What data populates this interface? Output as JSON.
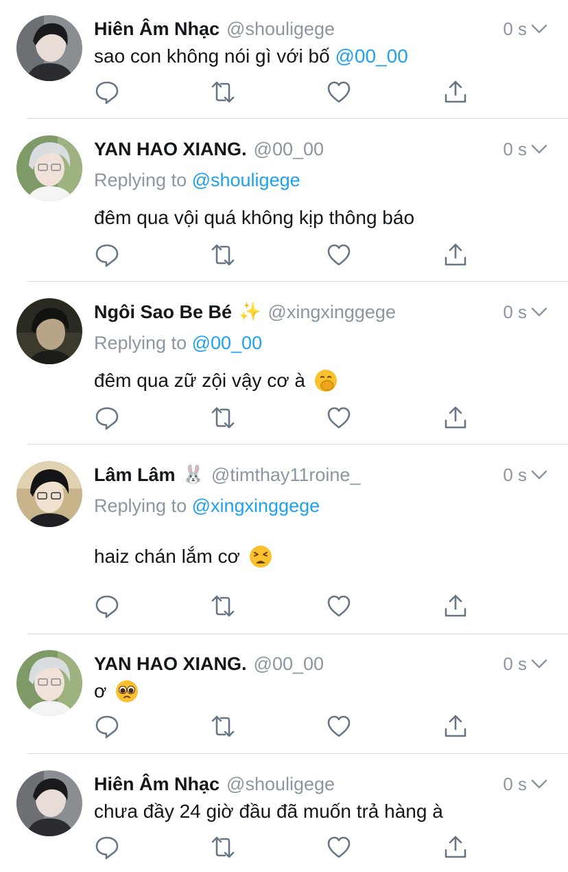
{
  "tweets": [
    {
      "display_name": "Hiên Âm Nhạc",
      "name_emoji": "",
      "handle": "@shouligege",
      "time": "0 s",
      "replying_label": "",
      "replying_to": "",
      "text": "sao con không nói gì với bố ",
      "text_mention": "@00_00",
      "text_emoji": ""
    },
    {
      "display_name": "YAN HAO XIANG.",
      "name_emoji": "",
      "handle": "@00_00",
      "time": "0 s",
      "replying_label": "Replying to ",
      "replying_to": "@shouligege",
      "text": "đêm qua vội quá không kịp thông báo",
      "text_mention": "",
      "text_emoji": ""
    },
    {
      "display_name": "Ngôi Sao Be Bé",
      "name_emoji": "✨",
      "handle": "@xingxinggege",
      "time": "0 s",
      "replying_label": "Replying to ",
      "replying_to": "@00_00",
      "text": "đêm qua zữ zội vậy cơ à",
      "text_mention": "",
      "text_emoji": "face-with-hand-over-mouth"
    },
    {
      "display_name": "Lâm Lâm",
      "name_emoji": "🐰",
      "handle": "@timthay11roine_",
      "time": "0 s",
      "replying_label": "Replying to ",
      "replying_to": "@xingxinggege",
      "text": "haiz chán lắm cơ",
      "text_mention": "",
      "text_emoji": "weary-face"
    },
    {
      "display_name": "YAN HAO XIANG.",
      "name_emoji": "",
      "handle": "@00_00",
      "time": "0 s",
      "replying_label": "",
      "replying_to": "",
      "text": "ơ",
      "text_mention": "",
      "text_emoji": "pleading-face"
    },
    {
      "display_name": "Hiên Âm Nhạc",
      "name_emoji": "",
      "handle": "@shouligege",
      "time": "0 s",
      "replying_label": "",
      "replying_to": "",
      "text": "chưa đầy 24 giờ đầu đã muốn trả hàng à",
      "text_mention": "",
      "text_emoji": ""
    }
  ],
  "icons": [
    "reply-icon",
    "retweet-icon",
    "like-icon",
    "share-icon",
    "chevron-down-icon"
  ],
  "colors": {
    "text": "#14171a",
    "muted": "#8c96a0",
    "mention": "#1da1f2",
    "icon": "#687684",
    "divider": "#d6dadf"
  }
}
